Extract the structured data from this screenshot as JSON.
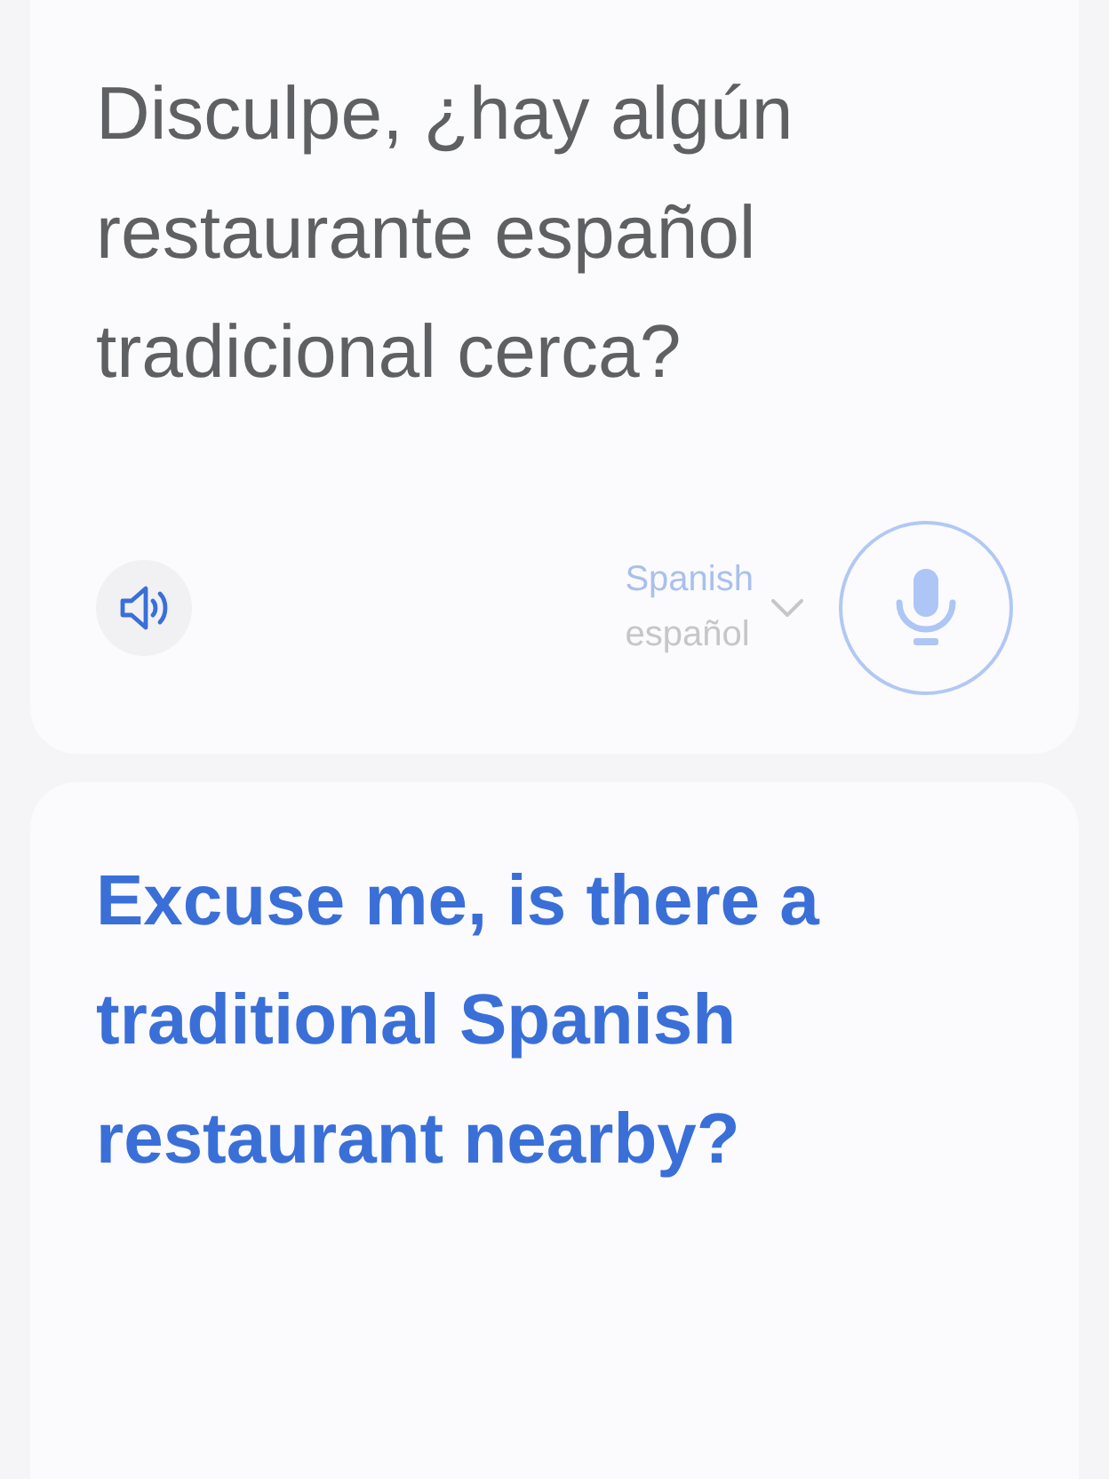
{
  "source": {
    "text": "Disculpe, ¿hay algún restaurante español tradicional cerca?",
    "language": "Spanish",
    "language_native": "español"
  },
  "translation": {
    "text": "Excuse me, is there a traditional Spanish restaurant nearby?"
  }
}
